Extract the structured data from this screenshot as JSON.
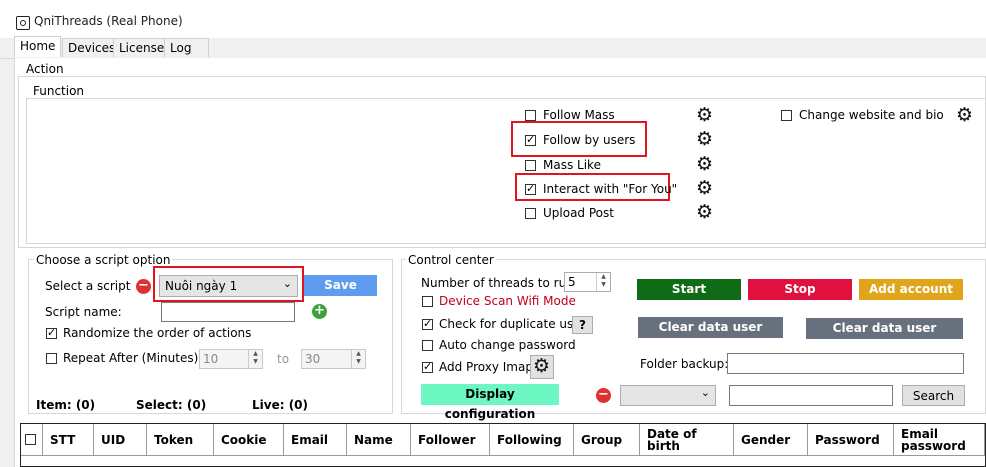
{
  "window": {
    "title": "QniThreads (Real Phone)"
  },
  "tabs": [
    "Home",
    "Devices",
    "License",
    "Log"
  ],
  "action": {
    "group_label": "Action",
    "function_label": "Function",
    "functions": [
      {
        "label": "Follow Mass",
        "checked": false
      },
      {
        "label": "Follow by users",
        "checked": true
      },
      {
        "label": "Mass Like",
        "checked": false
      },
      {
        "label": "Interact with \"For You\"",
        "checked": true
      },
      {
        "label": "Upload Post",
        "checked": false
      }
    ],
    "change_website": {
      "label": "Change website and bio",
      "checked": false
    }
  },
  "script_option": {
    "group_label": "Choose a script option",
    "select_label": "Select a script",
    "selected_script": "Nuôi ngày 1",
    "save_label": "Save",
    "script_name_label": "Script name:",
    "script_name_value": "",
    "randomize_label": "Randomize the order of actions",
    "randomize_checked": true,
    "repeat_label": "Repeat After (Minutes)",
    "repeat_checked": false,
    "repeat_from": "10",
    "repeat_to_label": "to",
    "repeat_to": "30"
  },
  "stats": {
    "item": "Item: (0)",
    "select": "Select: (0)",
    "live": "Live: (0)"
  },
  "control": {
    "group_label": "Control center",
    "threads_label": "Number of threads to run:",
    "threads_value": "5",
    "device_scan_label": "Device Scan Wifi Mode",
    "device_scan_checked": false,
    "check_dup_label": "Check for duplicate users",
    "check_dup_checked": true,
    "help_label": "?",
    "auto_change_label": "Auto change password",
    "auto_change_checked": false,
    "add_proxy_label": "Add Proxy Imap",
    "add_proxy_checked": true,
    "display_config_label": "Display configuration",
    "start_label": "Start",
    "stop_label": "Stop",
    "add_account_label": "Add account",
    "clear_follow_label": "Clear data user follow",
    "clear_message_label": "Clear data user message",
    "folder_backup_label": "Folder backup:",
    "folder_backup_value": "",
    "filter_value": "",
    "search_value": "",
    "search_label": "Search"
  },
  "table": {
    "columns": [
      "STT",
      "UID",
      "Token",
      "Cookie",
      "Email",
      "Name",
      "Follower",
      "Following",
      "Group",
      "Date of birth",
      "Gender",
      "Password",
      "Email password"
    ]
  },
  "colors": {
    "start": "#0f6b16",
    "stop": "#e0103f",
    "add_account": "#e0a51a",
    "clear_buttons": "#67717d",
    "display_config": "#6cf7c3",
    "save": "#5e9cf0",
    "highlight_border": "#e0151f"
  }
}
